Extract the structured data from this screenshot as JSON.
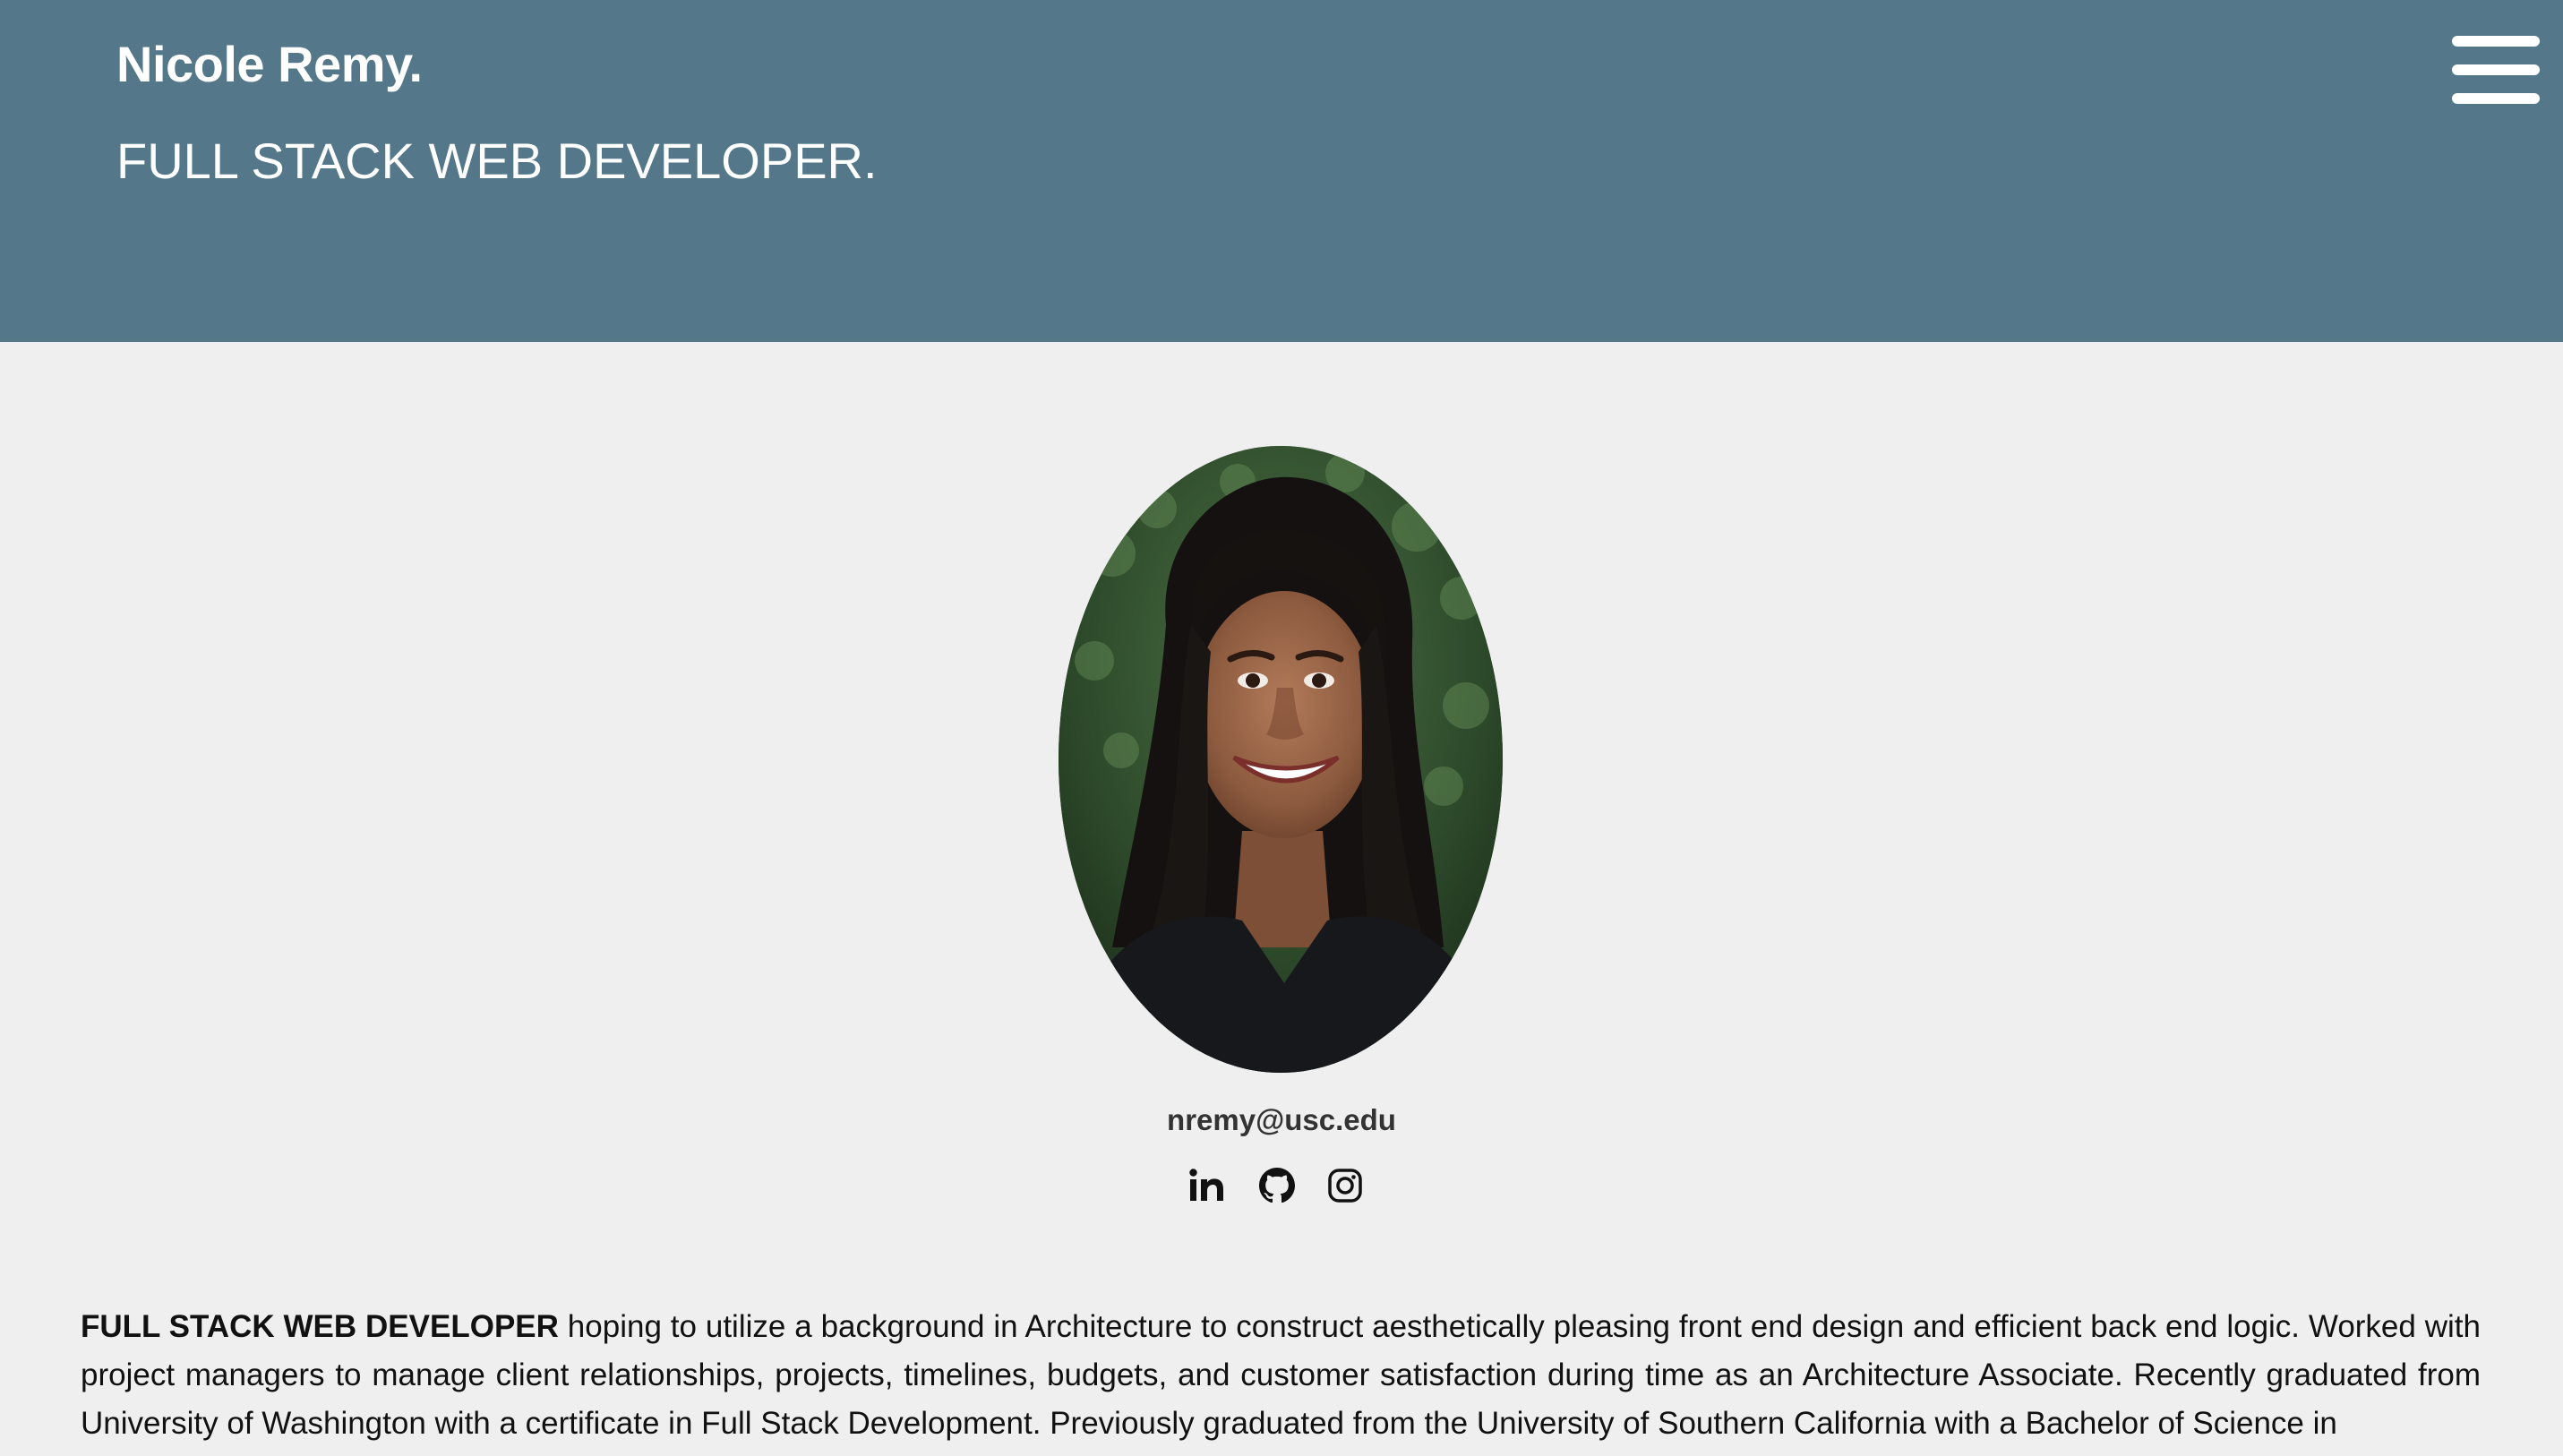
{
  "header": {
    "name": "Nicole Remy.",
    "tagline": "FULL STACK WEB DEVELOPER.",
    "menu_icon": "hamburger-menu-icon",
    "background_color": "#54788a"
  },
  "profile": {
    "portrait_alt": "Nicole Remy portrait",
    "email": "nremy@usc.edu",
    "social": [
      {
        "icon": "linkedin-icon"
      },
      {
        "icon": "github-icon"
      },
      {
        "icon": "instagram-icon"
      }
    ]
  },
  "about": {
    "lead": "FULL STACK WEB DEVELOPER",
    "text": " hoping to utilize a background in Architecture to construct aesthetically pleasing front end design and efficient back end logic. Worked with project managers to manage client relationships, projects, timelines, budgets, and customer satisfaction during time as an Architecture Associate. Recently graduated from University of Washington with a certificate in Full Stack Development. Previously graduated from the University of Southern California with a Bachelor of Science in"
  },
  "colors": {
    "page_background": "#efefef",
    "text": "#111111"
  }
}
